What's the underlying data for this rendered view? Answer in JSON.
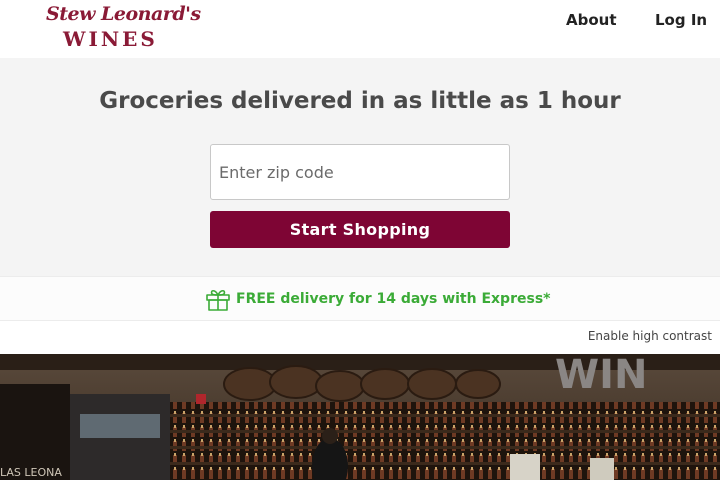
{
  "header": {
    "logo": {
      "script_text": "Stew Leonard's",
      "wordmark": "WINES"
    },
    "nav": {
      "about": "About",
      "login": "Log In"
    }
  },
  "hero": {
    "headline": "Groceries delivered in as little as 1 hour",
    "zip": {
      "value": "",
      "placeholder": "Enter zip code"
    },
    "cta_label": "Start Shopping"
  },
  "promo": {
    "icon": "gift-icon",
    "text": "FREE delivery for 14 days with Express*"
  },
  "accessibility": {
    "contrast_label": "Enable high contrast"
  },
  "store_photo": {
    "sign_text": "WIN",
    "store_sign": "LAS LEONA"
  },
  "colors": {
    "brand": "#7e0534",
    "promo_green": "#3bab37",
    "hero_bg": "#f4f4f4",
    "text_dark": "#4a4a4a"
  }
}
